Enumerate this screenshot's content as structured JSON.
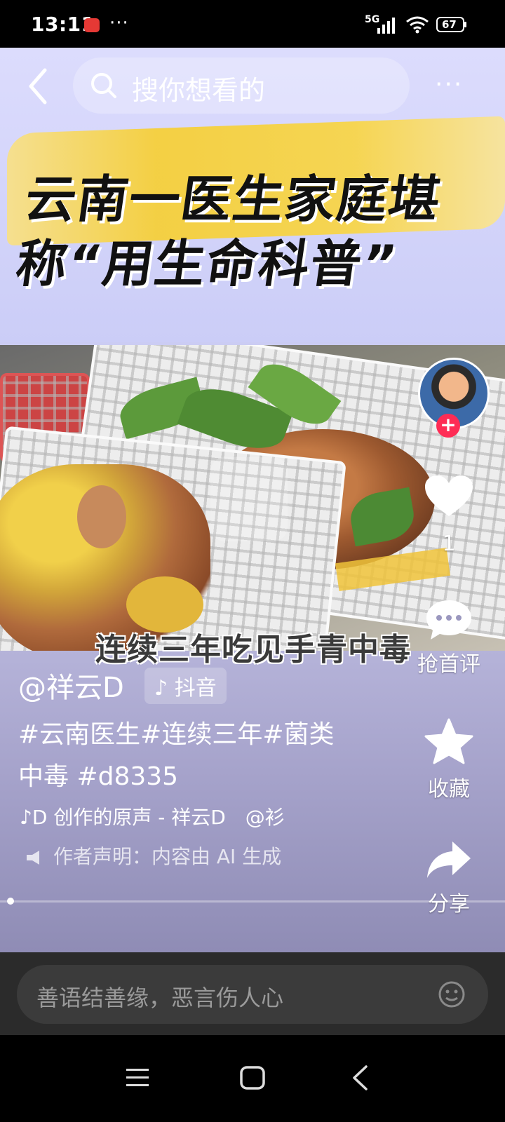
{
  "status": {
    "time": "13:11",
    "network": "5G",
    "battery": "67"
  },
  "search": {
    "placeholder": "搜你想看的"
  },
  "video": {
    "headline_line1": "云南一医生家庭堪",
    "headline_line2": "称“用生命科普”",
    "subtitle": "连续三年吃见手青中毒"
  },
  "post": {
    "author": "@祥云D",
    "platform": "抖音",
    "description": "#云南医生#连续三年#菌类中毒 #d8335",
    "music": "D 创作的原声 - 祥云D　@衫",
    "disclaimer": "作者声明：内容由 AI 生成"
  },
  "actions": {
    "like_count": "1",
    "comment_label": "抢首评",
    "favorite_label": "收藏",
    "share_label": "分享"
  },
  "comment": {
    "placeholder": "善语结善缘，恶言伤人心"
  },
  "colors": {
    "follow": "#fe2c55",
    "highlight": "#f5cf3a"
  }
}
